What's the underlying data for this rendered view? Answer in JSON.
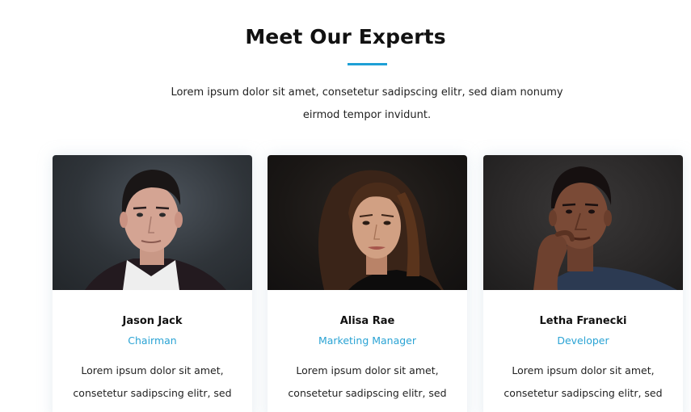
{
  "section": {
    "title": "Meet Our Experts",
    "intro": "Lorem ipsum dolor sit amet, consetetur sadipscing elitr, sed diam nonumy eirmod tempor invidunt.",
    "accent_color": "#1ea0d6"
  },
  "experts": [
    {
      "name": "Jason Jack",
      "role": "Chairman",
      "bio": "Lorem ipsum dolor sit amet, consetetur sadipscing elitr, sed"
    },
    {
      "name": "Alisa Rae",
      "role": "Marketing Manager",
      "bio": "Lorem ipsum dolor sit amet, consetetur sadipscing elitr, sed"
    },
    {
      "name": "Letha Franecki",
      "role": "Developer",
      "bio": "Lorem ipsum dolor sit amet, consetetur sadipscing elitr, sed"
    }
  ]
}
